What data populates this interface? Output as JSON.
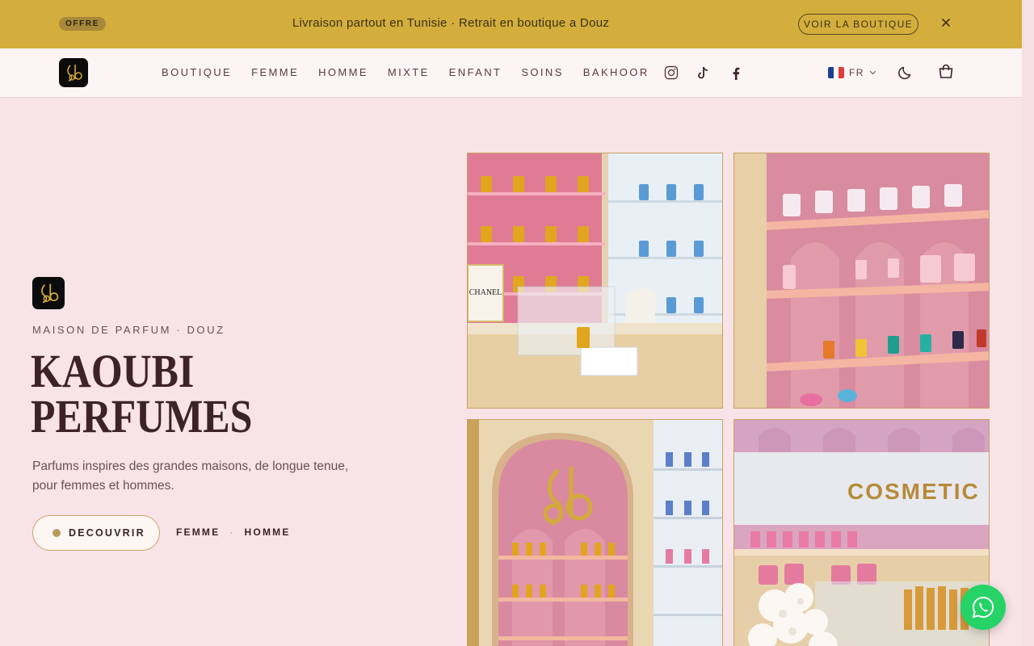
{
  "promo": {
    "badge": "OFFRE",
    "message": "Livraison partout en Tunisie · Retrait en boutique a Douz",
    "shop_button": "VOIR LA BOUTIQUE",
    "close_icon": "close-icon"
  },
  "nav": {
    "links": [
      "BOUTIQUE",
      "FEMME",
      "HOMME",
      "MIXTE",
      "ENFANT",
      "SOINS",
      "BAKHOOR"
    ],
    "social": [
      "instagram-icon",
      "tiktok-icon",
      "facebook-icon"
    ],
    "language": "FR",
    "icons": [
      "moon-icon",
      "shopping-bag-icon"
    ]
  },
  "hero": {
    "eyebrow": "MAISON DE PARFUM · DOUZ",
    "title_line1": "KAOUBI",
    "title_line2": "PERFUMES",
    "description": "Parfums inspires des grandes maisons, de longue tenue, pour femmes et hommes.",
    "cta_label": "DECOUVRIR",
    "link_femme": "FEMME",
    "link_separator": "·",
    "link_homme": "HOMME"
  },
  "gallery": {
    "sign_text": "COSMETIC",
    "display_label": "CHANEL"
  },
  "colors": {
    "promo_bg": "#d3ae3d",
    "page_bg": "#f7e3e8",
    "accent_gold": "#c8a25a",
    "whatsapp": "#25d366"
  }
}
